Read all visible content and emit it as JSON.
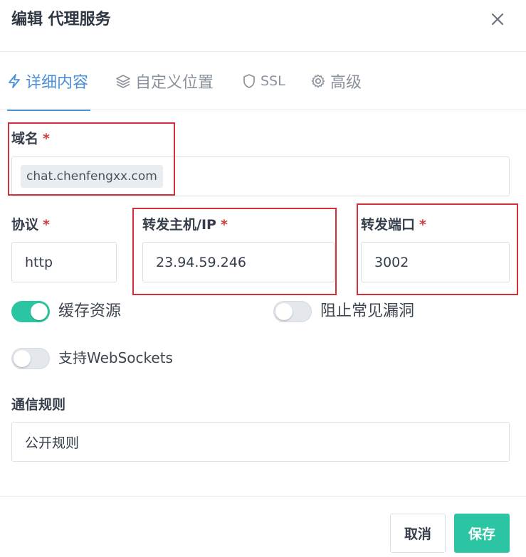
{
  "dialog": {
    "title": "编辑 代理服务"
  },
  "tabs": [
    {
      "label": "详细内容",
      "icon": "bolt-icon",
      "active": true
    },
    {
      "label": "自定义位置",
      "icon": "layers-icon",
      "active": false
    },
    {
      "label": "SSL",
      "icon": "shield-icon",
      "active": false
    },
    {
      "label": "高级",
      "icon": "gear-icon",
      "active": false
    }
  ],
  "form": {
    "domain": {
      "label": "域名",
      "required_mark": "*",
      "value": "chat.chenfengxx.com"
    },
    "scheme": {
      "label": "协议",
      "required_mark": "*",
      "value": "http"
    },
    "forward_host": {
      "label": "转发主机/IP",
      "required_mark": "*",
      "value": "23.94.59.246"
    },
    "forward_port": {
      "label": "转发端口",
      "required_mark": "*",
      "value": "3002"
    },
    "toggles": {
      "cache_assets": {
        "label": "缓存资源",
        "on": true
      },
      "block_exploits": {
        "label": "阻止常见漏洞",
        "on": false
      },
      "websockets": {
        "label": "支持WebSockets",
        "on": false
      }
    },
    "access_list": {
      "label": "通信规则",
      "value": "公开规则"
    }
  },
  "footer": {
    "cancel_label": "取消",
    "save_label": "保存"
  },
  "colors": {
    "accent": "#4a90d9",
    "primary_button": "#2cc5a3",
    "toggle_on": "#2cc5a3",
    "highlight": "#d32f3a",
    "required": "#cd3b3b"
  }
}
